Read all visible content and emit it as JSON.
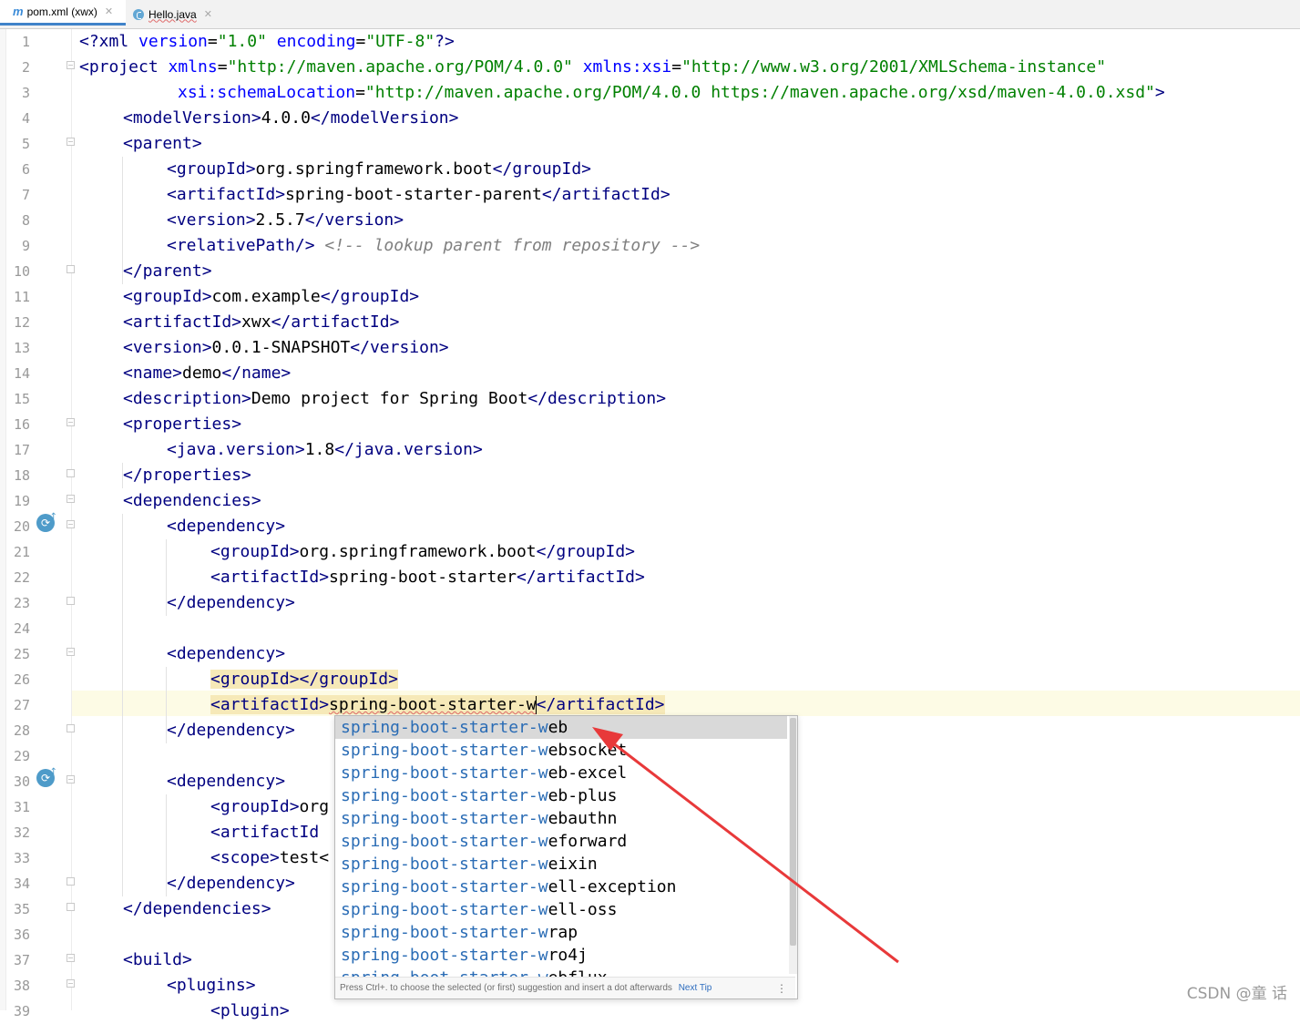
{
  "tabs": [
    {
      "label": "pom.xml (xwx)",
      "icon": "maven-m-icon",
      "active": true
    },
    {
      "label": "Hello.java",
      "icon": "java-class-icon",
      "active": false
    }
  ],
  "line_numbers": [
    "1",
    "2",
    "3",
    "4",
    "5",
    "6",
    "7",
    "8",
    "9",
    "10",
    "11",
    "12",
    "13",
    "14",
    "15",
    "16",
    "17",
    "18",
    "19",
    "20",
    "21",
    "22",
    "23",
    "24",
    "25",
    "26",
    "27",
    "28",
    "29",
    "30",
    "31",
    "32",
    "33",
    "34",
    "35",
    "36",
    "37",
    "38",
    "39"
  ],
  "code": {
    "l1": {
      "a": "<?xml ",
      "b": "version",
      "c": "=",
      "d": "\"1.0\"",
      "e": " encoding",
      "f": "=",
      "g": "\"UTF-8\"",
      "h": "?>"
    },
    "l2": {
      "a": "<project ",
      "b": "xmlns",
      "c": "=",
      "d": "\"http://maven.apache.org/POM/4.0.0\"",
      "e": " xmlns:xsi",
      "f": "=",
      "g": "\"http://www.w3.org/2001/XMLSchema-instance\""
    },
    "l3": {
      "a": "xsi:schemaLocation",
      "b": "=",
      "c": "\"http://maven.apache.org/POM/4.0.0 https://maven.apache.org/xsd/maven-4.0.0.xsd\"",
      "d": ">"
    },
    "l4": {
      "a": "<modelVersion>",
      "b": "4.0.0",
      "c": "</modelVersion>"
    },
    "l5": {
      "a": "<parent>"
    },
    "l6": {
      "a": "<groupId>",
      "b": "org.springframework.boot",
      "c": "</groupId>"
    },
    "l7": {
      "a": "<artifactId>",
      "b": "spring-boot-starter-parent",
      "c": "</artifactId>"
    },
    "l8": {
      "a": "<version>",
      "b": "2.5.7",
      "c": "</version>"
    },
    "l9": {
      "a": "<relativePath/>",
      "b": " <!-- lookup parent from repository -->"
    },
    "l10": {
      "a": "</parent>"
    },
    "l11": {
      "a": "<groupId>",
      "b": "com.example",
      "c": "</groupId>"
    },
    "l12": {
      "a": "<artifactId>",
      "b": "xwx",
      "c": "</artifactId>"
    },
    "l13": {
      "a": "<version>",
      "b": "0.0.1-SNAPSHOT",
      "c": "</version>"
    },
    "l14": {
      "a": "<name>",
      "b": "demo",
      "c": "</name>"
    },
    "l15": {
      "a": "<description>",
      "b": "Demo project for Spring Boot",
      "c": "</description>"
    },
    "l16": {
      "a": "<properties>"
    },
    "l17": {
      "a": "<java.version>",
      "b": "1.8",
      "c": "</java.version>"
    },
    "l18": {
      "a": "</properties>"
    },
    "l19": {
      "a": "<dependencies>"
    },
    "l20": {
      "a": "<dependency>"
    },
    "l21": {
      "a": "<groupId>",
      "b": "org.springframework.boot",
      "c": "</groupId>"
    },
    "l22": {
      "a": "<artifactId>",
      "b": "spring-boot-starter",
      "c": "</artifactId>"
    },
    "l23": {
      "a": "</dependency>"
    },
    "l25": {
      "a": "<dependency>"
    },
    "l26": {
      "a": "<groupId>",
      "b": "</groupId>"
    },
    "l27": {
      "a": "<artifactId>",
      "b": "spring-boot-starter-w",
      "c": "</artifactId>"
    },
    "l28": {
      "a": "</dependency>"
    },
    "l30": {
      "a": "<dependency>"
    },
    "l31": {
      "a": "<groupId>",
      "b": "org"
    },
    "l32": {
      "a": "<artifactId"
    },
    "l33": {
      "a": "<scope>",
      "b": "test<"
    },
    "l34": {
      "a": "</dependency>"
    },
    "l35": {
      "a": "</dependencies>"
    },
    "l37": {
      "a": "<build>"
    },
    "l38": {
      "a": "<plugins>"
    },
    "l39": {
      "a": "<plugin>"
    }
  },
  "completion": {
    "typed_prefix": "spring-boot-starter-w",
    "items": [
      {
        "prefix": "spring-boot-starter-w",
        "rest": "eb"
      },
      {
        "prefix": "spring-boot-starter-w",
        "rest": "ebsocket"
      },
      {
        "prefix": "spring-boot-starter-w",
        "rest": "eb-excel"
      },
      {
        "prefix": "spring-boot-starter-w",
        "rest": "eb-plus"
      },
      {
        "prefix": "spring-boot-starter-w",
        "rest": "ebauthn"
      },
      {
        "prefix": "spring-boot-starter-w",
        "rest": "eforward"
      },
      {
        "prefix": "spring-boot-starter-w",
        "rest": "eixin"
      },
      {
        "prefix": "spring-boot-starter-w",
        "rest": "ell-exception"
      },
      {
        "prefix": "spring-boot-starter-w",
        "rest": "ell-oss"
      },
      {
        "prefix": "spring-boot-starter-w",
        "rest": "rap"
      },
      {
        "prefix": "spring-boot-starter-w",
        "rest": "ro4j"
      },
      {
        "prefix": "spring-boot-starter-w",
        "rest": "ebflux"
      }
    ],
    "selected_index": 0,
    "footer_text": "Press Ctrl+. to choose the selected (or first) suggestion and insert a dot afterwards",
    "footer_link": "Next Tip",
    "menu_glyph": "⋮"
  },
  "watermark": "CSDN @童  话",
  "colors": {
    "tag": "#000080",
    "attr": "#0000ff",
    "value": "#008000",
    "comment": "#808080",
    "annotation_arrow": "#e8393a"
  }
}
